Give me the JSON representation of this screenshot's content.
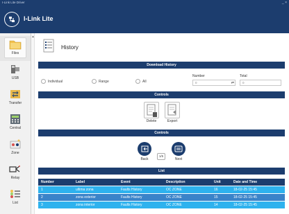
{
  "window": {
    "title": "I-Link Lite Driver",
    "controls": "_  ×"
  },
  "app": {
    "title": "I-Link Lite"
  },
  "sidebar": {
    "items": [
      {
        "label": "Files",
        "icon": "folder-icon"
      },
      {
        "label": "USB",
        "icon": "usb-icon"
      },
      {
        "label": "Transfer",
        "icon": "transfer-icon"
      },
      {
        "label": "Central",
        "icon": "central-panel-icon"
      },
      {
        "label": "Zone",
        "icon": "zone-icon"
      },
      {
        "label": "Relay",
        "icon": "relay-icon"
      },
      {
        "label": "List",
        "icon": "list-icon"
      }
    ],
    "scroll_arrow": "▲"
  },
  "page": {
    "title": "History",
    "icon": "history-document-icon"
  },
  "download_history": {
    "header": "Download History",
    "options": [
      "Individual",
      "Range",
      "All"
    ],
    "number_label": "Number",
    "number_value": "0",
    "total_label": "Total",
    "total_value": "0"
  },
  "controls_1": {
    "header": "Controls",
    "buttons": [
      {
        "label": "Delete",
        "icon": "delete-document-icon"
      },
      {
        "label": "Export",
        "icon": "export-document-icon"
      }
    ]
  },
  "controls_2": {
    "header": "Controls",
    "back_label": "Back",
    "vs_label": "1/5",
    "next_label": "Next"
  },
  "list": {
    "header": "List",
    "columns": [
      "Number",
      "Label",
      "Event",
      "Description",
      "Unit",
      "Date and Time"
    ],
    "rows": [
      [
        "1",
        "ultima zona",
        "Faults History",
        "OC ZONE",
        "16",
        "18-02-25 15:45"
      ],
      [
        "2",
        "zona exterior",
        "Faults History",
        "OC ZONE",
        "15",
        "18-02-25 15:45"
      ],
      [
        "3",
        "zona interior",
        "Faults History",
        "OC ZONE",
        "14",
        "18-02-25 15:45"
      ]
    ]
  },
  "colors": {
    "header_navy": "#1c3d6e",
    "row_highlight": "#2eb2ee",
    "row_alt": "#3a83c9",
    "accent_blue": "#1c3d6e"
  }
}
